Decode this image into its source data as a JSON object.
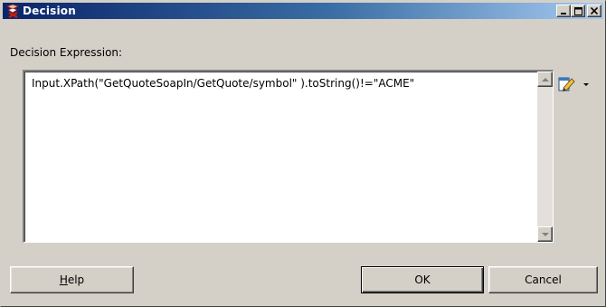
{
  "window": {
    "title": "Decision",
    "icon": "decision-app-icon",
    "controls": {
      "minimize": "_",
      "maximize": "□",
      "close": "✕"
    }
  },
  "expression_label": "Decision Expression:",
  "expression_value": "Input.XPath(\"GetQuoteSoapIn/GetQuote/symbol\" ).toString()!=\"ACME\"",
  "edit_button": {
    "icon": "edit-pencil-icon",
    "dropdown_icon": "dropdown-arrow-icon"
  },
  "buttons": {
    "help": {
      "mnemonic": "H",
      "rest": "elp"
    },
    "ok": "OK",
    "cancel": "Cancel"
  },
  "colors": {
    "titlebar_start": "#0a246a",
    "titlebar_end": "#a6caf0",
    "face": "#d4d0c8"
  }
}
